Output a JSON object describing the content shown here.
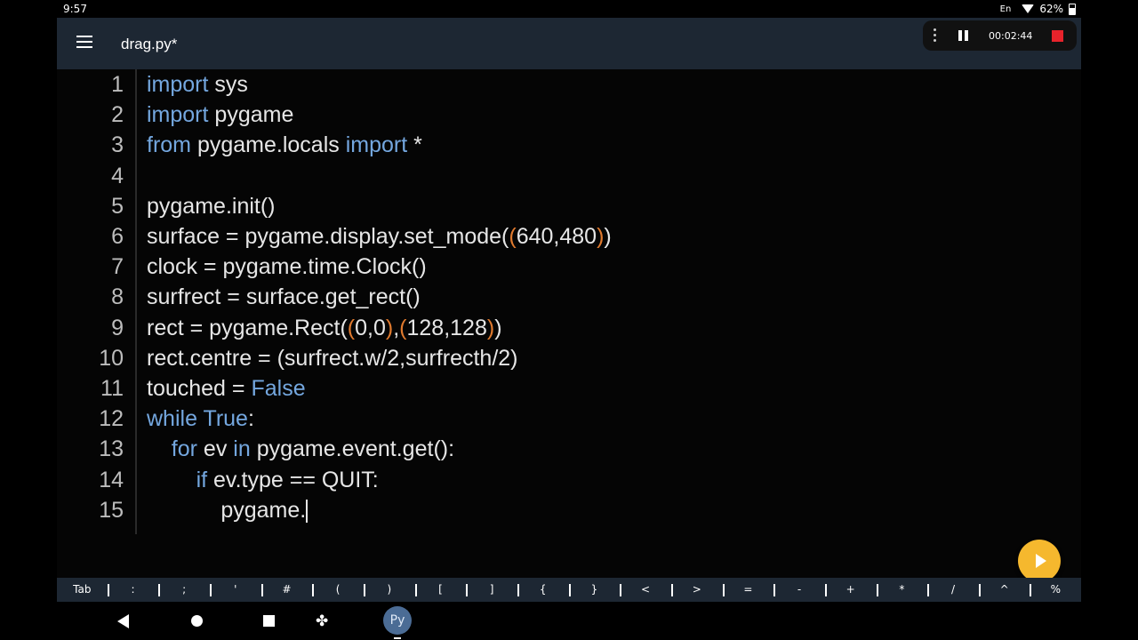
{
  "status_bar": {
    "time": "9:57",
    "lang": "En",
    "battery": "62%"
  },
  "app": {
    "file_title": "drag.py*"
  },
  "recorder": {
    "elapsed": "00:02:44"
  },
  "editor": {
    "lines": [
      {
        "num": "1",
        "tokens": [
          {
            "t": "import",
            "k": "kw"
          },
          {
            "t": " sys",
            "k": ""
          }
        ]
      },
      {
        "num": "2",
        "tokens": [
          {
            "t": "import",
            "k": "kw"
          },
          {
            "t": " pygame",
            "k": ""
          }
        ]
      },
      {
        "num": "3",
        "tokens": [
          {
            "t": "from",
            "k": "kw"
          },
          {
            "t": " pygame.locals ",
            "k": ""
          },
          {
            "t": "import",
            "k": "kw"
          },
          {
            "t": " *",
            "k": ""
          }
        ]
      },
      {
        "num": "4",
        "tokens": []
      },
      {
        "num": "5",
        "tokens": [
          {
            "t": "pygame.init()",
            "k": ""
          }
        ]
      },
      {
        "num": "6",
        "tokens": [
          {
            "t": "surface = pygame.display.set_mode(",
            "k": ""
          },
          {
            "t": "(",
            "k": "par"
          },
          {
            "t": "640,480",
            "k": ""
          },
          {
            "t": ")",
            "k": "par"
          },
          {
            "t": ")",
            "k": ""
          }
        ]
      },
      {
        "num": "7",
        "tokens": [
          {
            "t": "clock = pygame.time.Clock()",
            "k": ""
          }
        ]
      },
      {
        "num": "8",
        "tokens": [
          {
            "t": "surfrect = surface.get_rect()",
            "k": ""
          }
        ]
      },
      {
        "num": "9",
        "tokens": [
          {
            "t": "rect = pygame.Rect(",
            "k": ""
          },
          {
            "t": "(",
            "k": "par"
          },
          {
            "t": "0,0",
            "k": ""
          },
          {
            "t": ")",
            "k": "par"
          },
          {
            "t": ",",
            "k": ""
          },
          {
            "t": "(",
            "k": "par"
          },
          {
            "t": "128,128",
            "k": ""
          },
          {
            "t": ")",
            "k": "par"
          },
          {
            "t": ")",
            "k": ""
          }
        ]
      },
      {
        "num": "10",
        "tokens": [
          {
            "t": "rect.centre = (surfrect.w/2,surfrecth/2)",
            "k": ""
          }
        ]
      },
      {
        "num": "11",
        "tokens": [
          {
            "t": "touched = ",
            "k": ""
          },
          {
            "t": "False",
            "k": "kw"
          }
        ]
      },
      {
        "num": "12",
        "tokens": [
          {
            "t": "while",
            "k": "kw"
          },
          {
            "t": " ",
            "k": ""
          },
          {
            "t": "True",
            "k": "kw"
          },
          {
            "t": ":",
            "k": ""
          }
        ]
      },
      {
        "num": "13",
        "tokens": [
          {
            "t": "    ",
            "k": ""
          },
          {
            "t": "for",
            "k": "kw"
          },
          {
            "t": " ev ",
            "k": ""
          },
          {
            "t": "in",
            "k": "kw"
          },
          {
            "t": " pygame.event.get():",
            "k": ""
          }
        ]
      },
      {
        "num": "14",
        "tokens": [
          {
            "t": "        ",
            "k": ""
          },
          {
            "t": "if",
            "k": "kw"
          },
          {
            "t": " ev.type == QUIT:",
            "k": ""
          }
        ]
      },
      {
        "num": "15",
        "tokens": [
          {
            "t": "            pygame.",
            "k": ""
          }
        ],
        "cursor": true
      }
    ]
  },
  "keybar": {
    "keys": [
      "Tab",
      ":",
      ";",
      "'",
      "#",
      "(",
      ")",
      "[",
      "]",
      "{",
      "}",
      "<",
      ">",
      "=",
      "-",
      "+",
      "*",
      "/",
      "^",
      "%"
    ]
  },
  "navbar": {
    "python_label": "Py"
  }
}
